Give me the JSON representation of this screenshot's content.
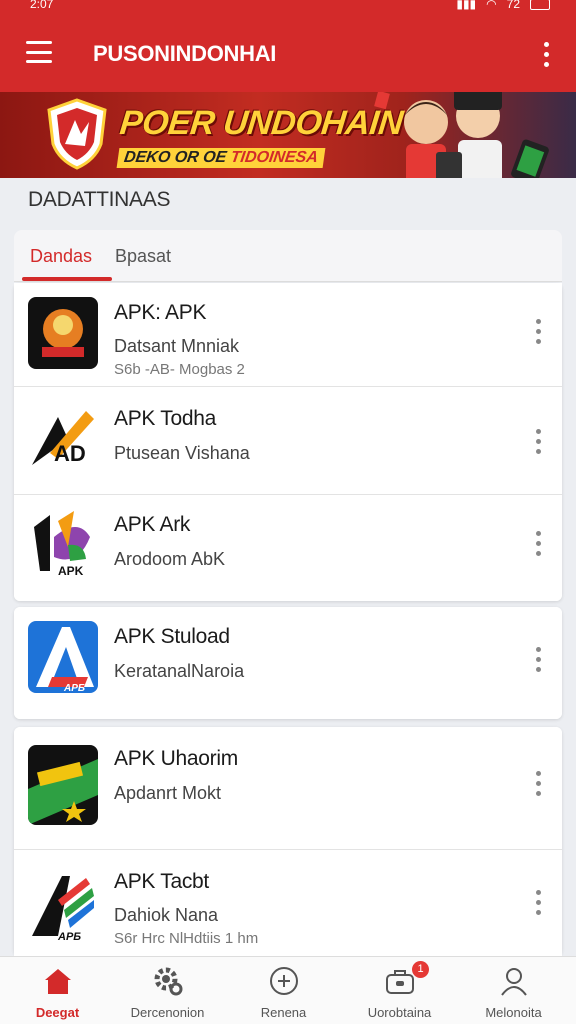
{
  "status_bar": {
    "time": "2:07",
    "battery": "72"
  },
  "app_bar": {
    "title": "PUSONINDONHAI"
  },
  "banner": {
    "headline": "POER UNDOHAIN",
    "sub_left": "DEKO OR OE ",
    "sub_right": "TIDOINESA"
  },
  "section_label": "DADATTINAAS",
  "tabs": [
    {
      "label": "Dandas",
      "active": true
    },
    {
      "label": "Bpasat",
      "active": false
    }
  ],
  "apps": [
    {
      "name": "APK: APK",
      "subtitle": "Datsant Mnniak",
      "meta": "S6b -AB- Mogbas 2",
      "icon": "apk-mascot-icon"
    },
    {
      "name": "APK Todha",
      "subtitle": "Ptusean Vishana",
      "meta": "",
      "icon": "apd-sword-icon"
    },
    {
      "name": "APK Ark",
      "subtitle": "Arodoom AbK",
      "meta": "",
      "icon": "apk-flag-icon"
    },
    {
      "name": "APK Stuload",
      "subtitle": "KeratanalNaroia",
      "meta": "",
      "icon": "apk-a-logo-icon"
    },
    {
      "name": "APK Uhaorim",
      "subtitle": "Apdanrt Mokt",
      "meta": "",
      "icon": "apk-green-star-icon"
    },
    {
      "name": "APK Tacbt",
      "subtitle": "Dahiok Nana",
      "meta": "S6r Hrc NlHdtiis 1 hm",
      "icon": "apk-stripes-icon"
    }
  ],
  "bottom_nav": [
    {
      "label": "Deegat",
      "icon": "home-icon",
      "active": true
    },
    {
      "label": "Dercenonion",
      "icon": "gear-icon",
      "active": false
    },
    {
      "label": "Renena",
      "icon": "plus-circle-icon",
      "active": false
    },
    {
      "label": "Uorobtaina",
      "icon": "briefcase-icon",
      "active": false,
      "badge": "1"
    },
    {
      "label": "Melonoita",
      "icon": "person-icon",
      "active": false
    }
  ],
  "colors": {
    "primary": "#d32a2a",
    "banner_text": "#ffd23a",
    "background": "#eceef2"
  }
}
